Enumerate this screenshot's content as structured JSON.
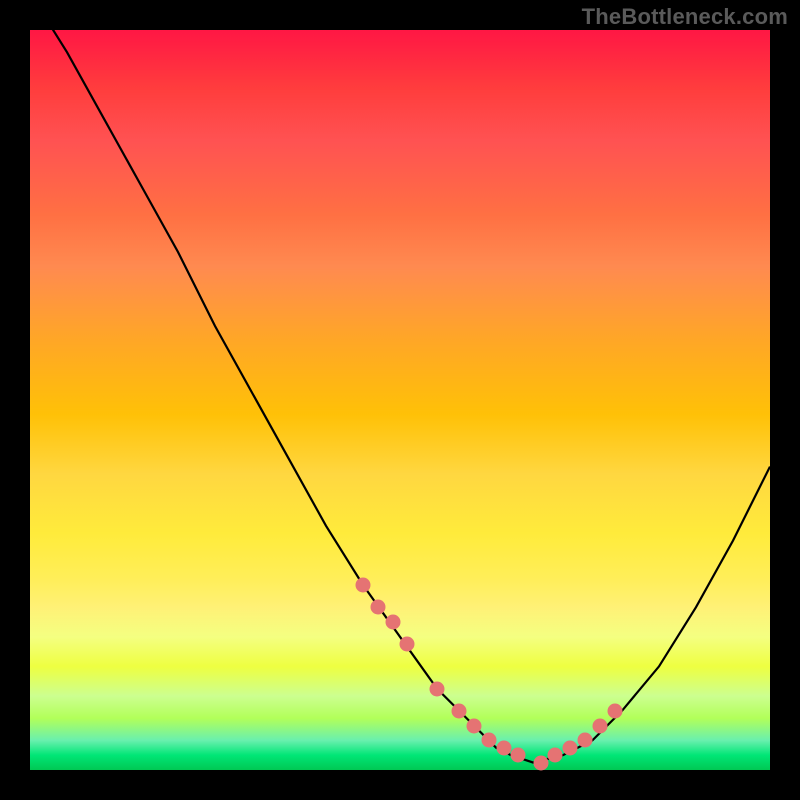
{
  "watermark": "TheBottleneck.com",
  "chart_data": {
    "type": "line",
    "title": "",
    "xlabel": "",
    "ylabel": "",
    "xlim": [
      0,
      100
    ],
    "ylim": [
      0,
      100
    ],
    "grid": false,
    "series": [
      {
        "name": "bottleneck-curve",
        "x": [
          0,
          5,
          10,
          15,
          20,
          25,
          30,
          35,
          40,
          45,
          50,
          55,
          60,
          63,
          65,
          68,
          72,
          76,
          80,
          85,
          90,
          95,
          100
        ],
        "y": [
          105,
          97,
          88,
          79,
          70,
          60,
          51,
          42,
          33,
          25,
          18,
          11,
          6,
          3,
          2,
          1,
          2,
          4,
          8,
          14,
          22,
          31,
          41
        ]
      }
    ],
    "markers": {
      "name": "optimal-range-dots",
      "x": [
        45,
        47,
        49,
        51,
        55,
        58,
        60,
        62,
        64,
        66,
        69,
        71,
        73,
        75,
        77,
        79
      ],
      "y": [
        25,
        22,
        20,
        17,
        11,
        8,
        6,
        4,
        3,
        2,
        1,
        2,
        3,
        4,
        6,
        8
      ]
    }
  }
}
